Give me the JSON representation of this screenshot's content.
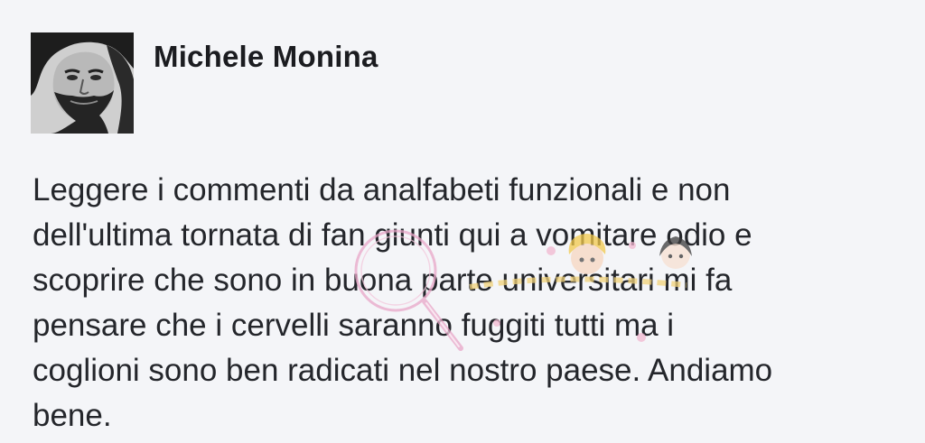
{
  "post": {
    "author": {
      "name": "Michele Monina",
      "avatar_icon": "bearded-man-portrait-avatar"
    },
    "text_lines": [
      "Leggere i commenti da analfabeti funzionali e non",
      "dell'ultima tornata di fan giunti qui a vomitare odio e",
      "scoprire che sono in buona parte universitari mi fa",
      "pensare che i cervelli saranno fuggiti tutti ma i",
      "coglioni sono ben radicati nel nostro paese. Andiamo",
      "bene."
    ]
  },
  "watermark": {
    "icon": "cartoon-girls-watermark-icon"
  },
  "colors": {
    "background": "#f4f5f8",
    "text": "#24262b",
    "name": "#1b1c20",
    "watermark_pink": "#e9a7c8"
  }
}
